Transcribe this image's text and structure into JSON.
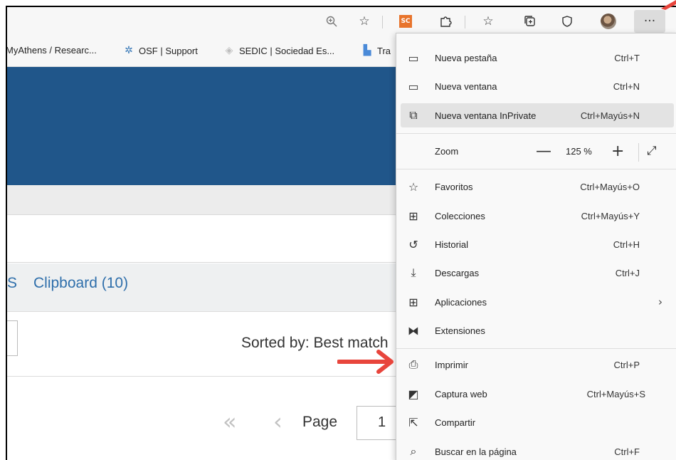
{
  "toolbar": {
    "zoom_icon": "zoom-in-magnifier-icon",
    "add_favorite_icon": "star-add-icon",
    "extension_sc": "SC",
    "extensions_icon": "puzzle-icon",
    "favorites_icon": "star-list-icon",
    "collections_icon": "collections-icon",
    "browser_essentials_icon": "shield-heart-icon",
    "profile_icon": "avatar-photo",
    "more_label": "···"
  },
  "favorites_bar": [
    {
      "label": "MyAthens / Researc...",
      "icon": "none"
    },
    {
      "label": "OSF | Support",
      "icon": "gear-icon"
    },
    {
      "label": "SEDIC | Sociedad Es...",
      "icon": "diamond-icon"
    },
    {
      "label": "Tra",
      "icon": "translate-icon"
    }
  ],
  "page": {
    "clip_prefix": "S",
    "clipboard_link": "Clipboard (10)",
    "sorted_by": "Sorted by: Best match",
    "page_label": "Page",
    "page_value": "1"
  },
  "menu": {
    "items": [
      {
        "label": "Nueva pestaña",
        "shortcut": "Ctrl+T",
        "icon": "new-tab-icon"
      },
      {
        "label": "Nueva ventana",
        "shortcut": "Ctrl+N",
        "icon": "new-window-icon"
      },
      {
        "label": "Nueva ventana InPrivate",
        "shortcut": "Ctrl+Mayús+N",
        "icon": "inprivate-window-icon"
      },
      {
        "label": "Favoritos",
        "shortcut": "Ctrl+Mayús+O",
        "icon": "favorites-icon"
      },
      {
        "label": "Colecciones",
        "shortcut": "Ctrl+Mayús+Y",
        "icon": "collections-icon"
      },
      {
        "label": "Historial",
        "shortcut": "Ctrl+H",
        "icon": "history-icon"
      },
      {
        "label": "Descargas",
        "shortcut": "Ctrl+J",
        "icon": "download-icon"
      },
      {
        "label": "Aplicaciones",
        "shortcut": "",
        "icon": "apps-icon"
      },
      {
        "label": "Extensiones",
        "shortcut": "",
        "icon": "puzzle-icon"
      },
      {
        "label": "Imprimir",
        "shortcut": "Ctrl+P",
        "icon": "printer-icon"
      },
      {
        "label": "Captura web",
        "shortcut": "Ctrl+Mayús+S",
        "icon": "web-capture-icon"
      },
      {
        "label": "Compartir",
        "shortcut": "",
        "icon": "share-icon"
      },
      {
        "label": "Buscar en la página",
        "shortcut": "Ctrl+F",
        "icon": "find-in-page-icon"
      }
    ],
    "zoom": {
      "label": "Zoom",
      "minus": "—",
      "level": "125 %",
      "plus": "+"
    }
  },
  "colors": {
    "banner": "#20568a",
    "link": "#2f6fab",
    "annotation_arrow": "#e8453c",
    "extension_badge": "#e8742c"
  }
}
